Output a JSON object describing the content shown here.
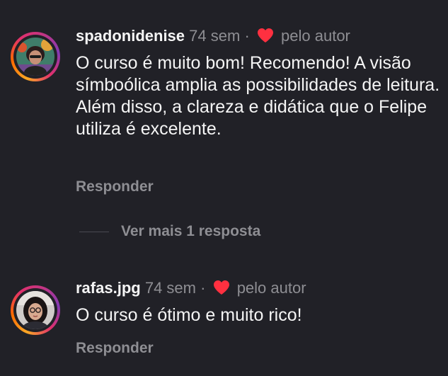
{
  "comments": [
    {
      "username": "spadonidenise",
      "age": "74 sem",
      "separator": "·",
      "liked_by_author_label": "pelo autor",
      "text": "O curso é muito bom! Recomendo! A visão símboólica amplia as possibilidades de leitura. Além disso, a clareza e didática que o Felipe utiliza é excelente.",
      "reply_label": "Responder",
      "more_replies_label": "Ver mais 1 resposta"
    },
    {
      "username": "rafas.jpg",
      "age": "74 sem",
      "separator": "·",
      "liked_by_author_label": "pelo autor",
      "text": "O curso é ótimo e muito rico!",
      "reply_label": "Responder"
    }
  ],
  "colors": {
    "background": "#212127",
    "primary_text": "#f5f5f5",
    "muted_text": "#8e8e93",
    "heart": "#ff3040"
  },
  "icons": {
    "liked_by_author": "heart-icon"
  }
}
